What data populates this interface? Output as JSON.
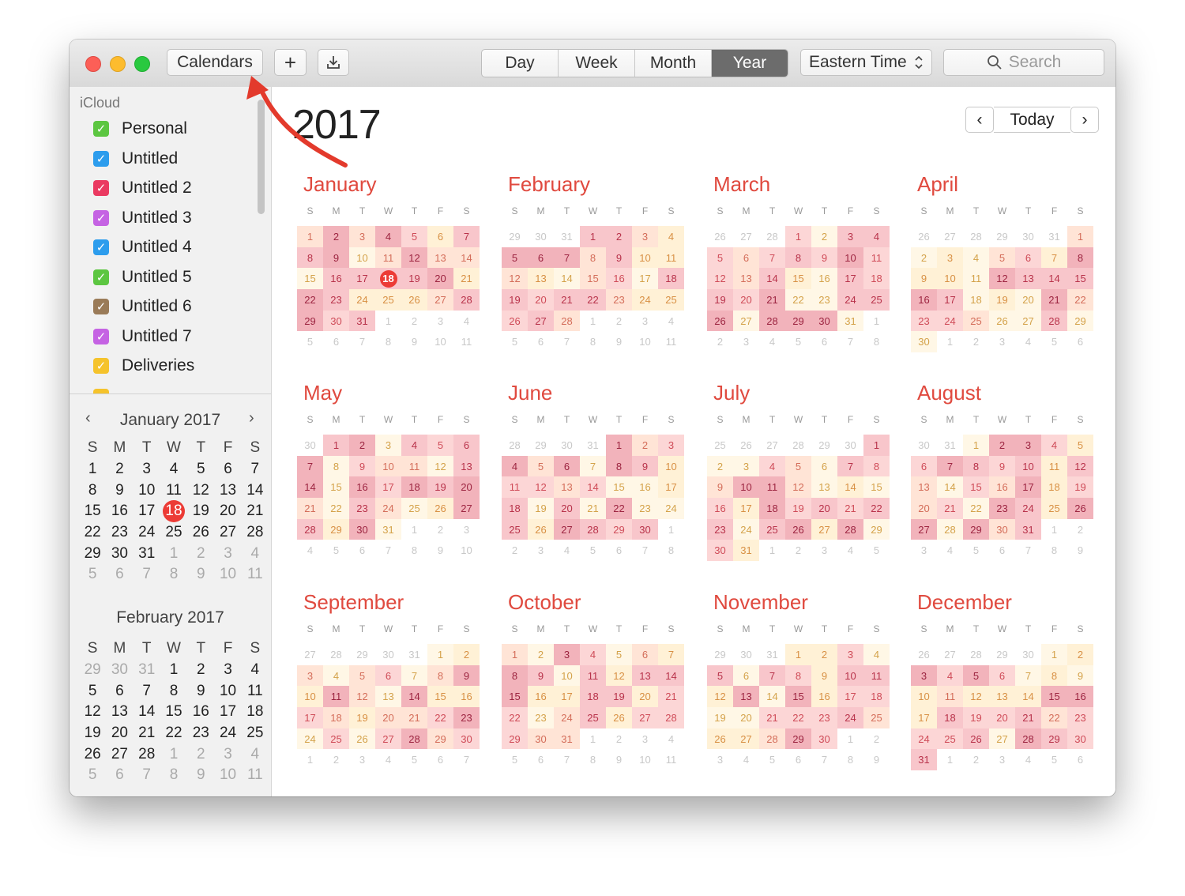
{
  "titlebar": {
    "calendars_label": "Calendars",
    "add_label": "+",
    "views": [
      "Day",
      "Week",
      "Month",
      "Year"
    ],
    "active_view": "Year",
    "timezone": "Eastern Time",
    "search_placeholder": "Search"
  },
  "sidebar": {
    "account": "iCloud",
    "calendars": [
      {
        "label": "Personal",
        "color": "#5cc641"
      },
      {
        "label": "Untitled",
        "color": "#2d9ded"
      },
      {
        "label": "Untitled 2",
        "color": "#ea3a61"
      },
      {
        "label": "Untitled 3",
        "color": "#c563e3"
      },
      {
        "label": "Untitled 4",
        "color": "#2d9ded"
      },
      {
        "label": "Untitled 5",
        "color": "#5cc641"
      },
      {
        "label": "Untitled 6",
        "color": "#9a7b58"
      },
      {
        "label": "Untitled 7",
        "color": "#c563e3"
      },
      {
        "label": "Deliveries",
        "color": "#f5c32c"
      }
    ],
    "mini_calendars": [
      {
        "title": "January 2017"
      },
      {
        "title": "February 2017"
      }
    ],
    "weekday_letters": [
      "S",
      "M",
      "T",
      "W",
      "T",
      "F",
      "S"
    ]
  },
  "main": {
    "year": "2017",
    "today_label": "Today",
    "prev_label": "‹",
    "next_label": "›",
    "month_names": [
      "January",
      "February",
      "March",
      "April",
      "May",
      "June",
      "July",
      "August",
      "September",
      "October",
      "November",
      "December"
    ],
    "weekday_letters": [
      "S",
      "M",
      "T",
      "W",
      "T",
      "F",
      "S"
    ],
    "today": {
      "month": 1,
      "day": 18
    }
  }
}
